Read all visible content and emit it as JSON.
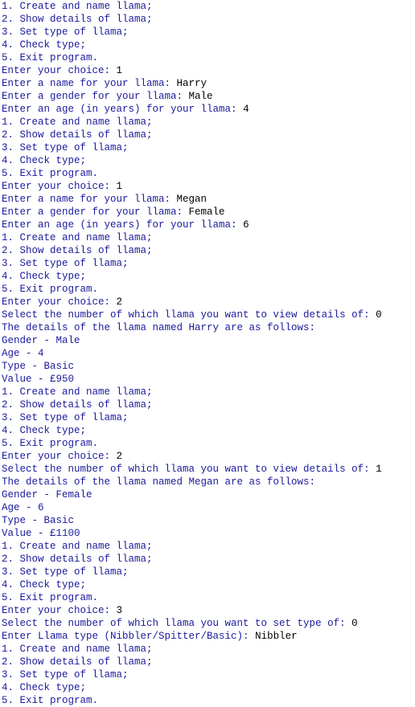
{
  "console": {
    "colors": {
      "program_text": "#1a1a9c",
      "user_input": "#000000",
      "background": "#ffffff"
    },
    "lines": [
      {
        "text": "1. Create and name llama;",
        "input": ""
      },
      {
        "text": "2. Show details of llama;",
        "input": ""
      },
      {
        "text": "3. Set type of llama;",
        "input": ""
      },
      {
        "text": "4. Check type;",
        "input": ""
      },
      {
        "text": "5. Exit program.",
        "input": ""
      },
      {
        "text": "Enter your choice: ",
        "input": "1"
      },
      {
        "text": "Enter a name for your llama: ",
        "input": "Harry"
      },
      {
        "text": "Enter a gender for your llama: ",
        "input": "Male"
      },
      {
        "text": "Enter an age (in years) for your llama: ",
        "input": "4"
      },
      {
        "text": "1. Create and name llama;",
        "input": ""
      },
      {
        "text": "2. Show details of llama;",
        "input": ""
      },
      {
        "text": "3. Set type of llama;",
        "input": ""
      },
      {
        "text": "4. Check type;",
        "input": ""
      },
      {
        "text": "5. Exit program.",
        "input": ""
      },
      {
        "text": "Enter your choice: ",
        "input": "1"
      },
      {
        "text": "Enter a name for your llama: ",
        "input": "Megan"
      },
      {
        "text": "Enter a gender for your llama: ",
        "input": "Female"
      },
      {
        "text": "Enter an age (in years) for your llama: ",
        "input": "6"
      },
      {
        "text": "1. Create and name llama;",
        "input": ""
      },
      {
        "text": "2. Show details of llama;",
        "input": ""
      },
      {
        "text": "3. Set type of llama;",
        "input": ""
      },
      {
        "text": "4. Check type;",
        "input": ""
      },
      {
        "text": "5. Exit program.",
        "input": ""
      },
      {
        "text": "Enter your choice: ",
        "input": "2"
      },
      {
        "text": "Select the number of which llama you want to view details of: ",
        "input": "0"
      },
      {
        "text": "The details of the llama named Harry are as follows:",
        "input": ""
      },
      {
        "text": "Gender - Male",
        "input": ""
      },
      {
        "text": "Age - 4",
        "input": ""
      },
      {
        "text": "Type - Basic",
        "input": ""
      },
      {
        "text": "Value - £950",
        "input": ""
      },
      {
        "text": "1. Create and name llama;",
        "input": ""
      },
      {
        "text": "2. Show details of llama;",
        "input": ""
      },
      {
        "text": "3. Set type of llama;",
        "input": ""
      },
      {
        "text": "4. Check type;",
        "input": ""
      },
      {
        "text": "5. Exit program.",
        "input": ""
      },
      {
        "text": "Enter your choice: ",
        "input": "2"
      },
      {
        "text": "Select the number of which llama you want to view details of: ",
        "input": "1"
      },
      {
        "text": "The details of the llama named Megan are as follows:",
        "input": ""
      },
      {
        "text": "Gender - Female",
        "input": ""
      },
      {
        "text": "Age - 6",
        "input": ""
      },
      {
        "text": "Type - Basic",
        "input": ""
      },
      {
        "text": "Value - £1100",
        "input": ""
      },
      {
        "text": "1. Create and name llama;",
        "input": ""
      },
      {
        "text": "2. Show details of llama;",
        "input": ""
      },
      {
        "text": "3. Set type of llama;",
        "input": ""
      },
      {
        "text": "4. Check type;",
        "input": ""
      },
      {
        "text": "5. Exit program.",
        "input": ""
      },
      {
        "text": "Enter your choice: ",
        "input": "3"
      },
      {
        "text": "Select the number of which llama you want to set type of: ",
        "input": "0"
      },
      {
        "text": "Enter Llama type (Nibbler/Spitter/Basic): ",
        "input": "Nibbler"
      },
      {
        "text": "1. Create and name llama;",
        "input": ""
      },
      {
        "text": "2. Show details of llama;",
        "input": ""
      },
      {
        "text": "3. Set type of llama;",
        "input": ""
      },
      {
        "text": "4. Check type;",
        "input": ""
      },
      {
        "text": "5. Exit program.",
        "input": ""
      }
    ]
  }
}
